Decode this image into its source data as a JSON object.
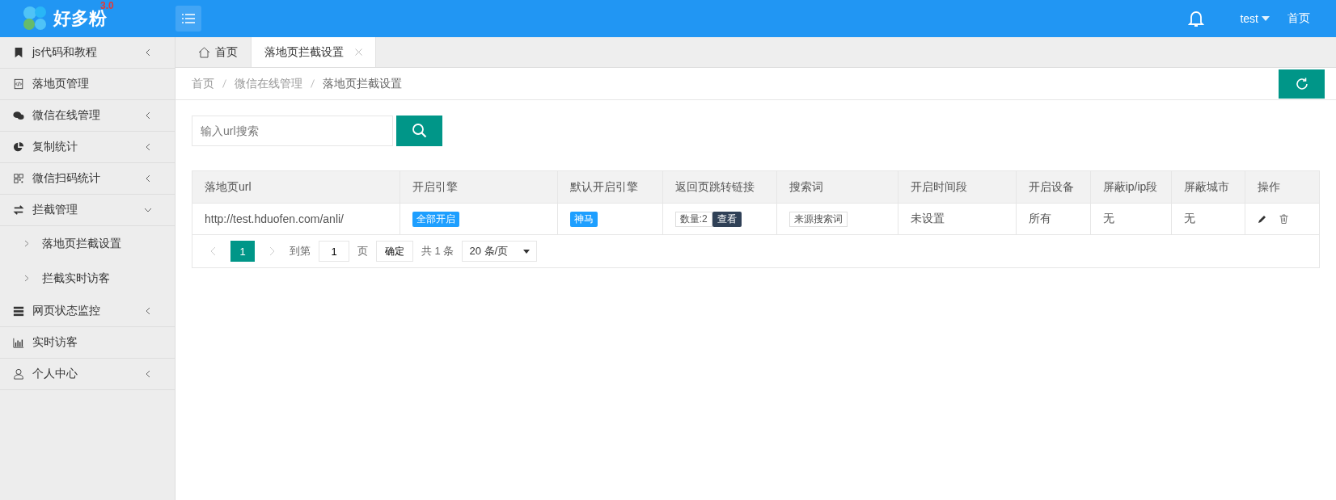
{
  "header": {
    "logo_text": "好多粉",
    "version": "3.0",
    "user": "test",
    "home_link": "首页"
  },
  "sidebar": {
    "items": [
      {
        "label": "js代码和教程",
        "expandable": true,
        "expanded": false
      },
      {
        "label": "落地页管理",
        "expandable": false
      },
      {
        "label": "微信在线管理",
        "expandable": true,
        "expanded": false
      },
      {
        "label": "复制统计",
        "expandable": true,
        "expanded": false
      },
      {
        "label": "微信扫码统计",
        "expandable": true,
        "expanded": false
      },
      {
        "label": "拦截管理",
        "expandable": true,
        "expanded": true,
        "children": [
          {
            "label": "落地页拦截设置"
          },
          {
            "label": "拦截实时访客"
          }
        ]
      },
      {
        "label": "网页状态监控",
        "expandable": true,
        "expanded": false
      },
      {
        "label": "实时访客",
        "expandable": false
      },
      {
        "label": "个人中心",
        "expandable": true,
        "expanded": false
      }
    ]
  },
  "tabs": [
    {
      "label": "首页",
      "selected": false,
      "closable": false
    },
    {
      "label": "落地页拦截设置",
      "selected": true,
      "closable": true
    }
  ],
  "breadcrumb": [
    "首页",
    "微信在线管理",
    "落地页拦截设置"
  ],
  "search": {
    "placeholder": "输入url搜索"
  },
  "table": {
    "columns": [
      "落地页url",
      "开启引擎",
      "默认开启引擎",
      "返回页跳转链接",
      "搜索词",
      "开启时间段",
      "开启设备",
      "屏蔽ip/ip段",
      "屏蔽城市",
      "操作"
    ],
    "rows": [
      {
        "url": "http://test.hduofen.com/anli/",
        "engine": "全部开启",
        "default_engine": "神马",
        "return_count": "数量:2",
        "return_view": "查看",
        "keyword": "来源搜索词",
        "time_range": "未设置",
        "devices": "所有",
        "blocked_ip": "无",
        "blocked_city": "无"
      }
    ]
  },
  "pagination": {
    "pages": [
      {
        "label": "1",
        "selected": true
      }
    ],
    "goto_label": "到第",
    "goto_value": "1",
    "page_unit": "页",
    "confirm": "确定",
    "total": "共 1 条",
    "page_size": "20 条/页"
  }
}
